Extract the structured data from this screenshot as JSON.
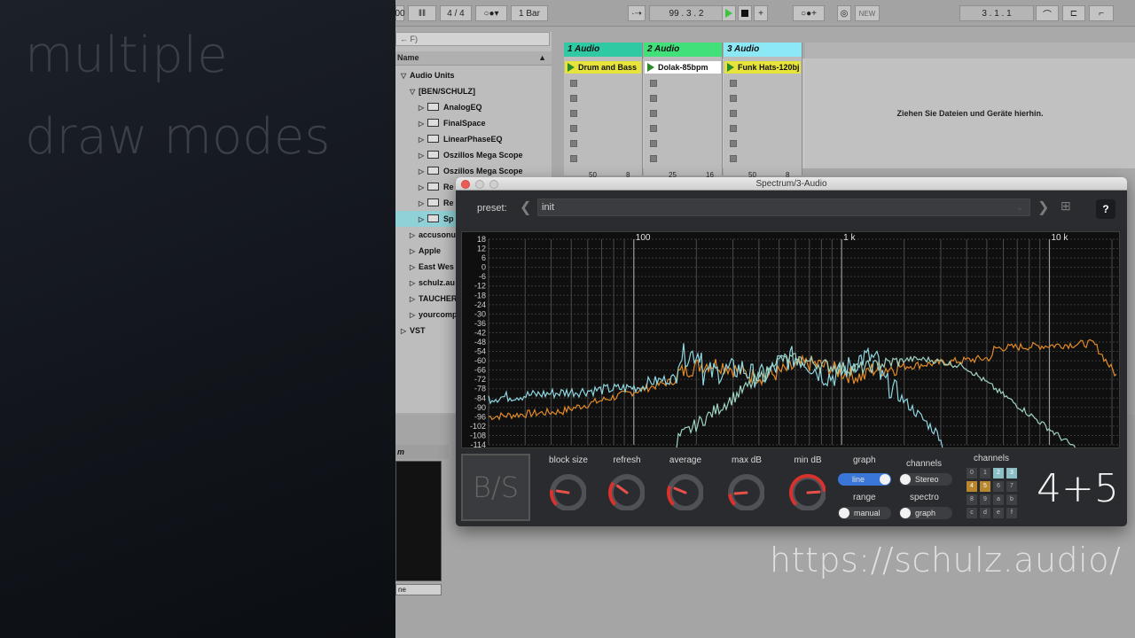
{
  "promo": {
    "line1": "multiple",
    "line2": "draw modes",
    "url": "https://schulz.audio/"
  },
  "transport": {
    "bars_left": "00",
    "signature": "4 / 4",
    "quantize": "1 Bar",
    "position": "99 .   3 .   2",
    "loop_pos": "3 .   1 .   1",
    "new_label": "NEW"
  },
  "browser": {
    "search_placeholder": "← F)",
    "header": "Name",
    "items": [
      {
        "label": "Audio Units",
        "indent": 0,
        "tri": "▽",
        "plugin": false,
        "selected": false
      },
      {
        "label": "[BEN/SCHULZ]",
        "indent": 1,
        "tri": "▽",
        "plugin": false,
        "selected": false
      },
      {
        "label": "AnalogEQ",
        "indent": 2,
        "tri": "▷",
        "plugin": true,
        "selected": false
      },
      {
        "label": "FinalSpace",
        "indent": 2,
        "tri": "▷",
        "plugin": true,
        "selected": false
      },
      {
        "label": "LinearPhaseEQ",
        "indent": 2,
        "tri": "▷",
        "plugin": true,
        "selected": false
      },
      {
        "label": "Oszillos Mega Scope",
        "indent": 2,
        "tri": "▷",
        "plugin": true,
        "selected": false
      },
      {
        "label": "Oszillos Mega Scope",
        "indent": 2,
        "tri": "▷",
        "plugin": true,
        "selected": false
      },
      {
        "label": "Re",
        "indent": 2,
        "tri": "▷",
        "plugin": true,
        "selected": false
      },
      {
        "label": "Re",
        "indent": 2,
        "tri": "▷",
        "plugin": true,
        "selected": false
      },
      {
        "label": "Sp",
        "indent": 2,
        "tri": "▷",
        "plugin": true,
        "selected": true
      },
      {
        "label": "accusonu",
        "indent": 1,
        "tri": "▷",
        "plugin": false,
        "selected": false
      },
      {
        "label": "Apple",
        "indent": 1,
        "tri": "▷",
        "plugin": false,
        "selected": false
      },
      {
        "label": "East Wes",
        "indent": 1,
        "tri": "▷",
        "plugin": false,
        "selected": false
      },
      {
        "label": "schulz.au",
        "indent": 1,
        "tri": "▷",
        "plugin": false,
        "selected": false
      },
      {
        "label": "TAUCHER",
        "indent": 1,
        "tri": "▷",
        "plugin": false,
        "selected": false
      },
      {
        "label": "yourcomp",
        "indent": 1,
        "tri": "▷",
        "plugin": false,
        "selected": false
      },
      {
        "label": "VST",
        "indent": 0,
        "tri": "▷",
        "plugin": false,
        "selected": false
      }
    ]
  },
  "tracks": [
    {
      "name": "1 Audio",
      "color": "#2fc9a4",
      "clip": "Drum and Bass",
      "clip_color": "#e6e43a",
      "foot": "50",
      "foot2": "8"
    },
    {
      "name": "2 Audio",
      "color": "#41e07b",
      "clip": "Dolak-85bpm",
      "clip_color": "#ffffff",
      "foot": "25",
      "foot2": "16"
    },
    {
      "name": "3 Audio",
      "color": "#8de8f5",
      "clip": "Funk Hats-120bj",
      "clip_color": "#e6e43a",
      "foot": "50",
      "foot2": "8"
    }
  ],
  "dropzone": "Ziehen Sie Dateien und Geräte hierhin.",
  "device": {
    "title": "m",
    "select": "ne"
  },
  "plugin": {
    "title": "Spectrum/3-Audio",
    "preset_label": "preset:",
    "preset_value": "init",
    "help": "?",
    "logo": "B/S",
    "knobs": [
      {
        "label": "block size",
        "value": 0.2
      },
      {
        "label": "refresh",
        "value": 0.3
      },
      {
        "label": "average",
        "value": 0.25
      },
      {
        "label": "max dB",
        "value": 0.15
      },
      {
        "label": "min dB",
        "value": 0.82
      }
    ],
    "graph_label": "graph",
    "graph_toggle": "line",
    "channels_label": "channels",
    "channels_toggle": "Stereo",
    "range_label": "range",
    "range_toggle": "manual",
    "spectro_label": "spectro",
    "spectro_toggle": "graph",
    "channel_grid_label": "channels",
    "channel_cells": [
      "0",
      "1",
      "2",
      "3",
      "4",
      "5",
      "6",
      "7",
      "8",
      "9",
      "a",
      "b",
      "c",
      "d",
      "e",
      "f"
    ],
    "big_text": "4+5",
    "freq_labels": [
      "100",
      "1 k",
      "10 k"
    ],
    "db_labels": [
      "18",
      "12",
      "6",
      "0",
      "-6",
      "-12",
      "-18",
      "-24",
      "-30",
      "-36",
      "-42",
      "-48",
      "-54",
      "-60",
      "-66",
      "-72",
      "-78",
      "-84",
      "-90",
      "-96",
      "-102",
      "-108",
      "-114"
    ],
    "colors": {
      "accent": "#3a76d8",
      "orange": "#e08a2a",
      "cyan": "#8fd6e0",
      "teal": "#9fd3c0",
      "knob_red": "#d9312b"
    }
  }
}
